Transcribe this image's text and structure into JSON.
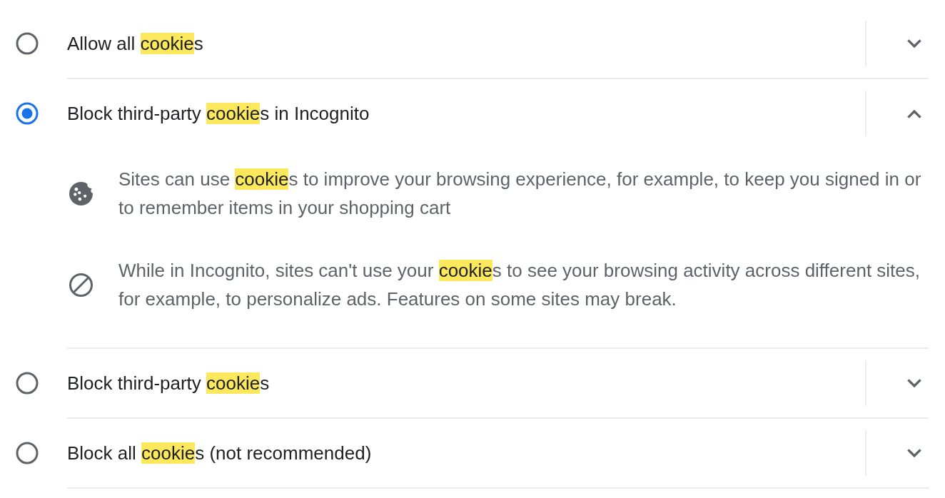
{
  "options": [
    {
      "label": [
        {
          "text": "Allow all ",
          "highlight": false
        },
        {
          "text": "cookie",
          "highlight": true
        },
        {
          "text": "s",
          "highlight": false
        }
      ],
      "selected": false,
      "expanded": false
    },
    {
      "label": [
        {
          "text": "Block third-party ",
          "highlight": false
        },
        {
          "text": "cookie",
          "highlight": true
        },
        {
          "text": "s in Incognito",
          "highlight": false
        }
      ],
      "selected": true,
      "expanded": true,
      "details": [
        {
          "kind": "cookie",
          "text": [
            {
              "text": "Sites can use ",
              "highlight": false
            },
            {
              "text": "cookie",
              "highlight": true
            },
            {
              "text": "s to improve your browsing experience, for example, to keep you signed in or to remember items in your shopping cart",
              "highlight": false
            }
          ]
        },
        {
          "kind": "blocked",
          "text": [
            {
              "text": "While in Incognito, sites can't use your ",
              "highlight": false
            },
            {
              "text": "cookie",
              "highlight": true
            },
            {
              "text": "s to see your browsing activity across different sites, for example, to personalize ads. Features on some sites may break.",
              "highlight": false
            }
          ]
        }
      ]
    },
    {
      "label": [
        {
          "text": "Block third-party ",
          "highlight": false
        },
        {
          "text": "cookie",
          "highlight": true
        },
        {
          "text": "s",
          "highlight": false
        }
      ],
      "selected": false,
      "expanded": false
    },
    {
      "label": [
        {
          "text": "Block all ",
          "highlight": false
        },
        {
          "text": "cookie",
          "highlight": true
        },
        {
          "text": "s (not recommended)",
          "highlight": false
        }
      ],
      "selected": false,
      "expanded": false
    }
  ]
}
